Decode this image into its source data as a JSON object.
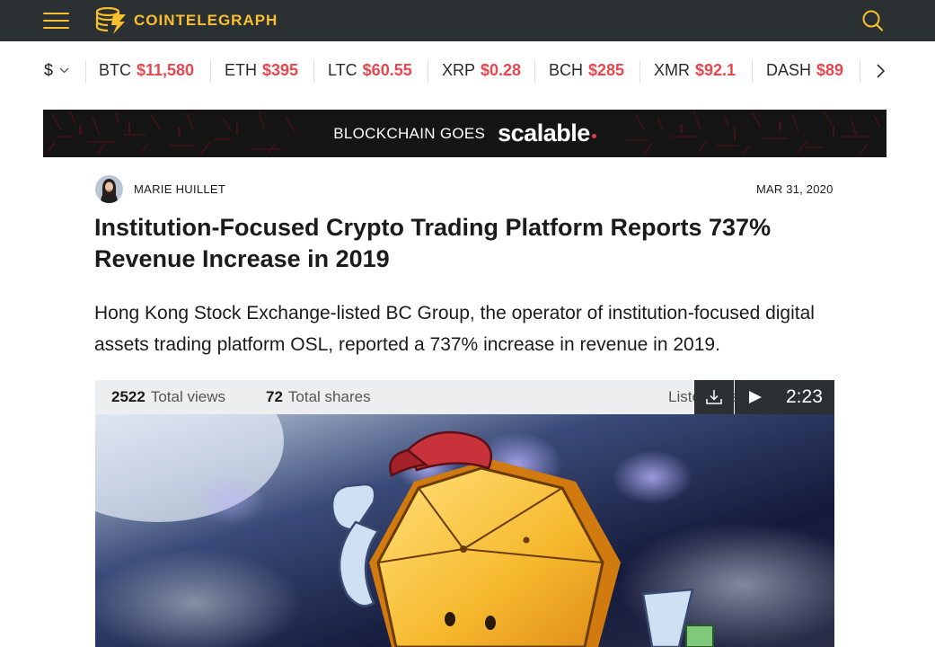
{
  "header": {
    "brand": "COINTELEGRAPH",
    "menu_icon": "hamburger-icon",
    "search_icon": "search-icon",
    "accent_color": "#fabf2c",
    "background_color": "#2b3133"
  },
  "ticker": {
    "currency": "$",
    "items": [
      {
        "symbol": "BTC",
        "price": "$11,580"
      },
      {
        "symbol": "ETH",
        "price": "$395"
      },
      {
        "symbol": "LTC",
        "price": "$60.55"
      },
      {
        "symbol": "XRP",
        "price": "$0.28"
      },
      {
        "symbol": "BCH",
        "price": "$285"
      },
      {
        "symbol": "XMR",
        "price": "$92.1"
      },
      {
        "symbol": "DASH",
        "price": "$89"
      }
    ],
    "price_color": "#e8474e"
  },
  "banner": {
    "pre_text": "BLOCKCHAIN GOES",
    "brand_text": "scalable"
  },
  "article": {
    "author": "MARIE HUILLET",
    "date": "MAR 31, 2020",
    "headline": "Institution-Focused Crypto Trading Platform Reports 737% Revenue Increase in 2019",
    "lede": "Hong Kong Stock Exchange-listed BC Group, the operator of institution-focused digital assets trading platform OSL, reported a 737% increase in revenue in 2019."
  },
  "stats": {
    "views_count": "2522",
    "views_label": "Total views",
    "shares_count": "72",
    "shares_label": "Total shares",
    "listen_label": "Listen to article",
    "duration": "2:23"
  }
}
